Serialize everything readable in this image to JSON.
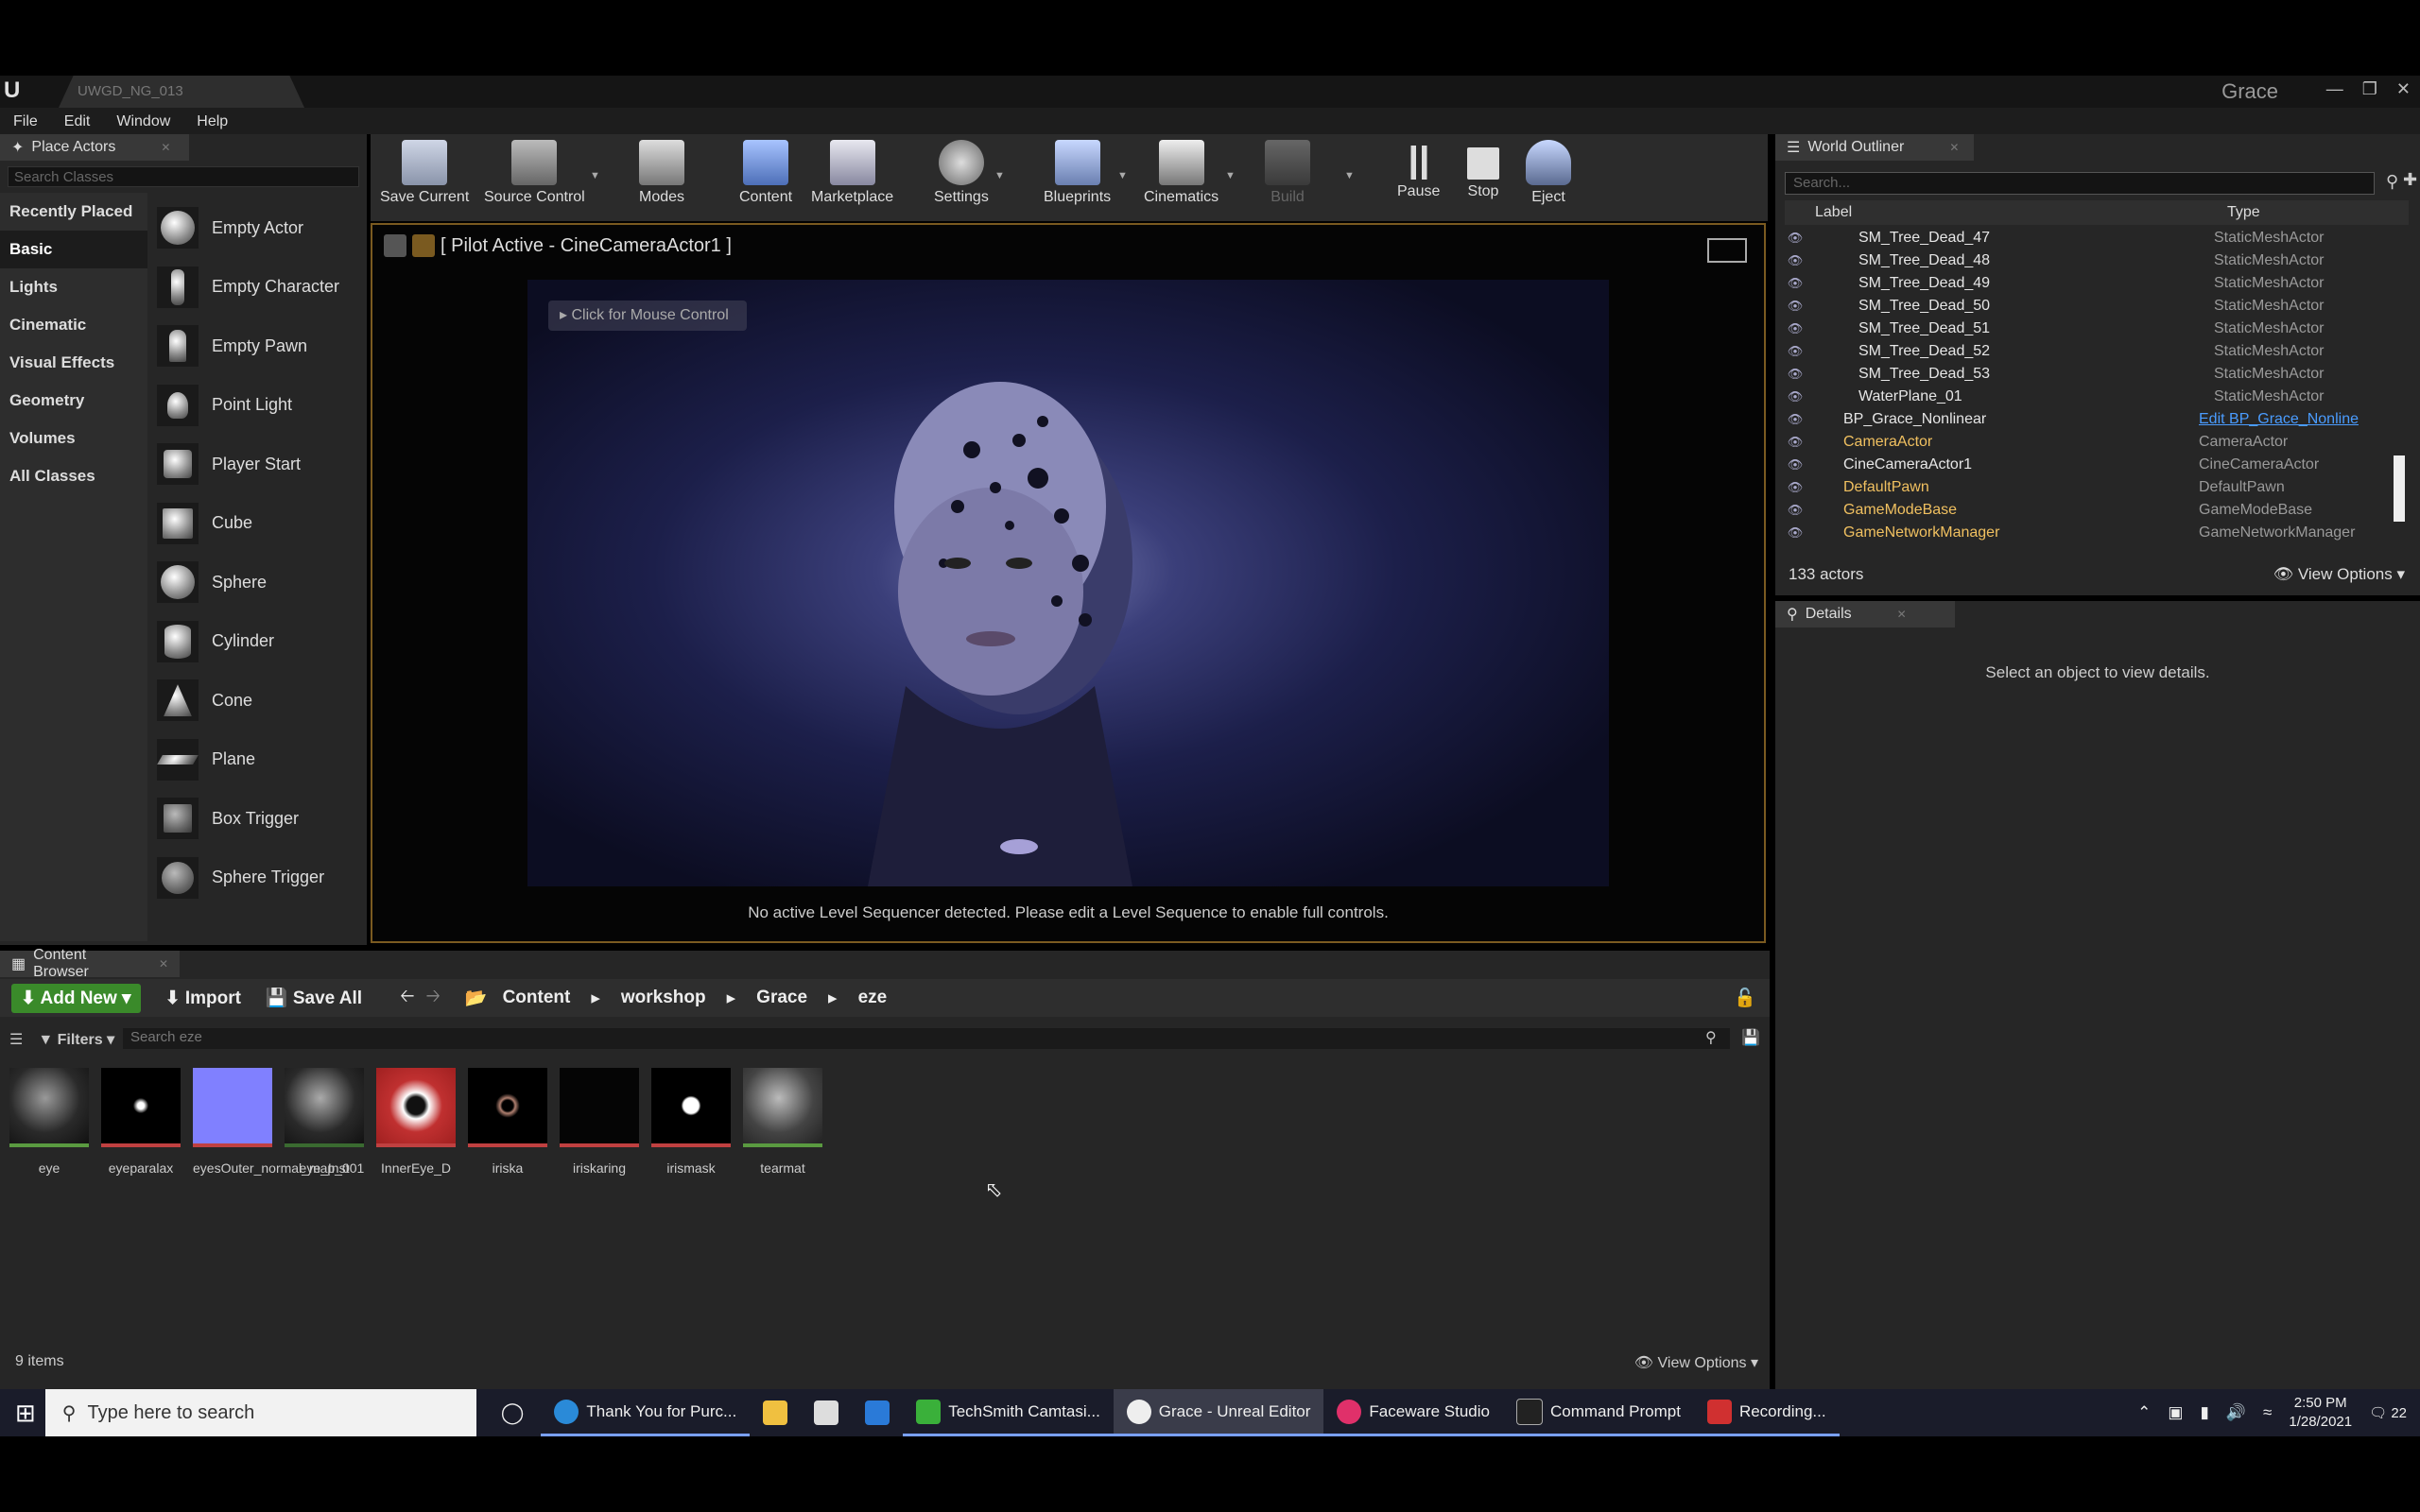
{
  "window": {
    "level_tab": "UWGD_NG_013",
    "project": "Grace"
  },
  "menu": [
    "File",
    "Edit",
    "Window",
    "Help"
  ],
  "place_actors": {
    "tab": "Place Actors",
    "search_placeholder": "Search Classes",
    "categories": [
      "Recently Placed",
      "Basic",
      "Lights",
      "Cinematic",
      "Visual Effects",
      "Geometry",
      "Volumes",
      "All Classes"
    ],
    "selected_category": "Basic",
    "items": [
      "Empty Actor",
      "Empty Character",
      "Empty Pawn",
      "Point Light",
      "Player Start",
      "Cube",
      "Sphere",
      "Cylinder",
      "Cone",
      "Plane",
      "Box Trigger",
      "Sphere Trigger"
    ]
  },
  "toolbar": {
    "save_current": "Save Current",
    "source_control": "Source Control",
    "modes": "Modes",
    "content": "Content",
    "marketplace": "Marketplace",
    "settings": "Settings",
    "blueprints": "Blueprints",
    "cinematics": "Cinematics",
    "build": "Build",
    "pause": "Pause",
    "stop": "Stop",
    "eject": "Eject"
  },
  "viewport": {
    "header": "[ Pilot Active - CineCameraActor1 ]",
    "click_hint": "Click for Mouse Control",
    "message": "No active Level Sequencer detected. Please edit a Level Sequence to enable full controls."
  },
  "outliner": {
    "tab": "World Outliner",
    "search_placeholder": "Search...",
    "col_label": "Label",
    "col_type": "Type",
    "rows": [
      {
        "label": "SM_Tree_Dead_47",
        "type": "StaticMeshActor"
      },
      {
        "label": "SM_Tree_Dead_48",
        "type": "StaticMeshActor"
      },
      {
        "label": "SM_Tree_Dead_49",
        "type": "StaticMeshActor"
      },
      {
        "label": "SM_Tree_Dead_50",
        "type": "StaticMeshActor"
      },
      {
        "label": "SM_Tree_Dead_51",
        "type": "StaticMeshActor"
      },
      {
        "label": "SM_Tree_Dead_52",
        "type": "StaticMeshActor"
      },
      {
        "label": "SM_Tree_Dead_53",
        "type": "StaticMeshActor"
      },
      {
        "label": "WaterPlane_01",
        "type": "StaticMeshActor"
      },
      {
        "label": "BP_Grace_Nonlinear",
        "type": "Edit BP_Grace_Nonline"
      },
      {
        "label": "CameraActor",
        "type": "CameraActor"
      },
      {
        "label": "CineCameraActor1",
        "type": "CineCameraActor"
      },
      {
        "label": "DefaultPawn",
        "type": "DefaultPawn"
      },
      {
        "label": "GameModeBase",
        "type": "GameModeBase"
      },
      {
        "label": "GameNetworkManager",
        "type": "GameNetworkManager"
      }
    ],
    "count": "133 actors",
    "view_options": "View Options"
  },
  "details": {
    "tab": "Details",
    "empty": "Select an object to view details."
  },
  "content_browser": {
    "tab": "Content Browser",
    "add_new": "Add New",
    "import": "Import",
    "save_all": "Save All",
    "breadcrumb": [
      "Content",
      "workshop",
      "Grace",
      "eze"
    ],
    "filters": "Filters",
    "search_placeholder": "Search eze",
    "assets": [
      "eye",
      "eyeparalax",
      "eyesOuter_normal_map_001",
      "eye_Inst",
      "InnerEye_D",
      "iriska",
      "iriskaring",
      "irismask",
      "tearmat"
    ],
    "item_count": "9 items",
    "view_options": "View Options"
  },
  "taskbar": {
    "search_placeholder": "Type here to search",
    "apps": [
      "Thank You for Purc...",
      "TechSmith Camtasi...",
      "Grace - Unreal Editor",
      "Faceware Studio",
      "Command Prompt",
      "Recording..."
    ],
    "time": "2:50 PM",
    "date": "1/28/2021",
    "notifications": "22"
  }
}
